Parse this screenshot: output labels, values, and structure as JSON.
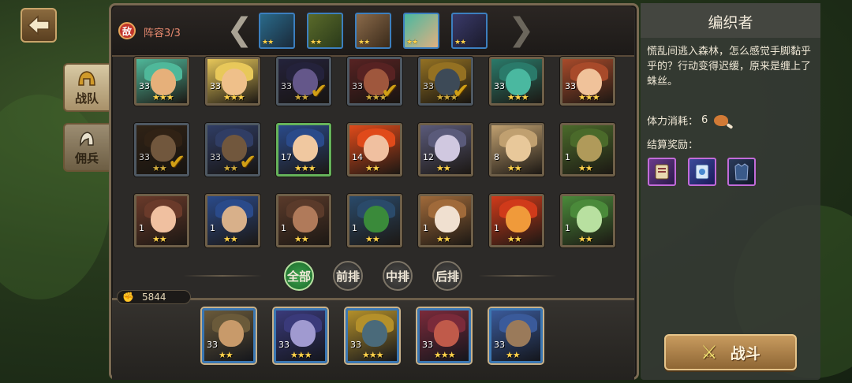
{
  "header": {
    "enemy_badge": "敌",
    "lineup_count": "阵容3/3",
    "prev_arrow": "❮",
    "next_arrow": "❯"
  },
  "enemies": [
    {
      "stars": "★★"
    },
    {
      "stars": "★★"
    },
    {
      "stars": "★★"
    },
    {
      "stars": "★★"
    },
    {
      "stars": "★★"
    }
  ],
  "side_tabs": {
    "team": "战队",
    "mercenary": "佣兵"
  },
  "heroes": [
    {
      "level": "33",
      "stars": "★★★",
      "checked": false,
      "highlight": false,
      "colors": [
        "#e6b07a",
        "#4fb89a"
      ]
    },
    {
      "level": "33",
      "stars": "★★★",
      "checked": false,
      "highlight": false,
      "colors": [
        "#efc08a",
        "#e8c85a"
      ]
    },
    {
      "level": "33",
      "stars": "★★",
      "checked": true,
      "highlight": false,
      "colors": [
        "#7a6aa8",
        "#2c2a48"
      ]
    },
    {
      "level": "33",
      "stars": "★★★",
      "checked": true,
      "highlight": false,
      "colors": [
        "#c26a4a",
        "#6a2a2a"
      ]
    },
    {
      "level": "33",
      "stars": "★★★",
      "checked": true,
      "highlight": false,
      "colors": [
        "#4a5a6a",
        "#b48a2a"
      ]
    },
    {
      "level": "33",
      "stars": "★★★",
      "checked": false,
      "highlight": false,
      "colors": [
        "#4ab8a0",
        "#2a7a6a"
      ]
    },
    {
      "level": "33",
      "stars": "★★★",
      "checked": false,
      "highlight": false,
      "colors": [
        "#f0c29a",
        "#a84a2a"
      ]
    },
    {
      "level": "33",
      "stars": "★★",
      "checked": true,
      "highlight": false,
      "colors": [
        "#8a6a4a",
        "#3a2a1a"
      ]
    },
    {
      "level": "33",
      "stars": "★★",
      "checked": true,
      "highlight": false,
      "colors": [
        "#8a6a4a",
        "#3a4a7a"
      ]
    },
    {
      "level": "17",
      "stars": "★★★",
      "checked": false,
      "highlight": true,
      "colors": [
        "#f0c8a0",
        "#2a4a8a"
      ]
    },
    {
      "level": "14",
      "stars": "★★",
      "checked": false,
      "highlight": false,
      "colors": [
        "#f0c0a0",
        "#e04a1a"
      ]
    },
    {
      "level": "12",
      "stars": "★★",
      "checked": false,
      "highlight": false,
      "colors": [
        "#d0c8e0",
        "#5a5a7a"
      ]
    },
    {
      "level": "8",
      "stars": "★★",
      "checked": false,
      "highlight": false,
      "colors": [
        "#e8c89a",
        "#c0a070"
      ]
    },
    {
      "level": "1",
      "stars": "★★",
      "checked": false,
      "highlight": false,
      "colors": [
        "#b09a5a",
        "#4a6a2a"
      ]
    },
    {
      "level": "1",
      "stars": "★★",
      "checked": false,
      "highlight": false,
      "colors": [
        "#f0c0a0",
        "#6a3a2a"
      ]
    },
    {
      "level": "1",
      "stars": "★★",
      "checked": false,
      "highlight": false,
      "colors": [
        "#d8b08a",
        "#2a4a8a"
      ]
    },
    {
      "level": "1",
      "stars": "★★",
      "checked": false,
      "highlight": false,
      "colors": [
        "#b07a5a",
        "#5a3a2a"
      ]
    },
    {
      "level": "1",
      "stars": "★★",
      "checked": false,
      "highlight": false,
      "colors": [
        "#3a8a3a",
        "#2a4a6a"
      ]
    },
    {
      "level": "1",
      "stars": "★★",
      "checked": false,
      "highlight": false,
      "colors": [
        "#f0e0d0",
        "#a06a3a"
      ]
    },
    {
      "level": "1",
      "stars": "★★",
      "checked": false,
      "highlight": false,
      "colors": [
        "#f09a3a",
        "#d03a1a"
      ]
    },
    {
      "level": "1",
      "stars": "★★",
      "checked": false,
      "highlight": false,
      "colors": [
        "#b8e0a0",
        "#4a8a3a"
      ]
    }
  ],
  "filters": [
    "全部",
    "前排",
    "中排",
    "后排"
  ],
  "power": "5844",
  "team": [
    {
      "level": "33",
      "stars": "★★",
      "colors": [
        "#c89a6a",
        "#6a5a3a"
      ]
    },
    {
      "level": "33",
      "stars": "★★★",
      "colors": [
        "#a09ad0",
        "#3a3a7a"
      ]
    },
    {
      "level": "33",
      "stars": "★★★",
      "colors": [
        "#4a6a7a",
        "#b4902a"
      ]
    },
    {
      "level": "33",
      "stars": "★★★",
      "colors": [
        "#c05a4a",
        "#7a2a3a"
      ]
    },
    {
      "level": "33",
      "stars": "★★",
      "colors": [
        "#9a7a5a",
        "#3a5a9a"
      ]
    }
  ],
  "info": {
    "title": "编织者",
    "description": "慌乱间逃入森林，怎么感觉手脚黏乎乎的？行动变得迟缓，原来是缠上了蛛丝。",
    "stamina_label": "体力消耗：",
    "stamina_value": "6",
    "reward_label": "结算奖励："
  },
  "battle_button": "战斗",
  "colors": {
    "accent_gold": "#ffd24a",
    "enemy_red": "#c2352b",
    "filter_active": "#2f8a3e"
  }
}
